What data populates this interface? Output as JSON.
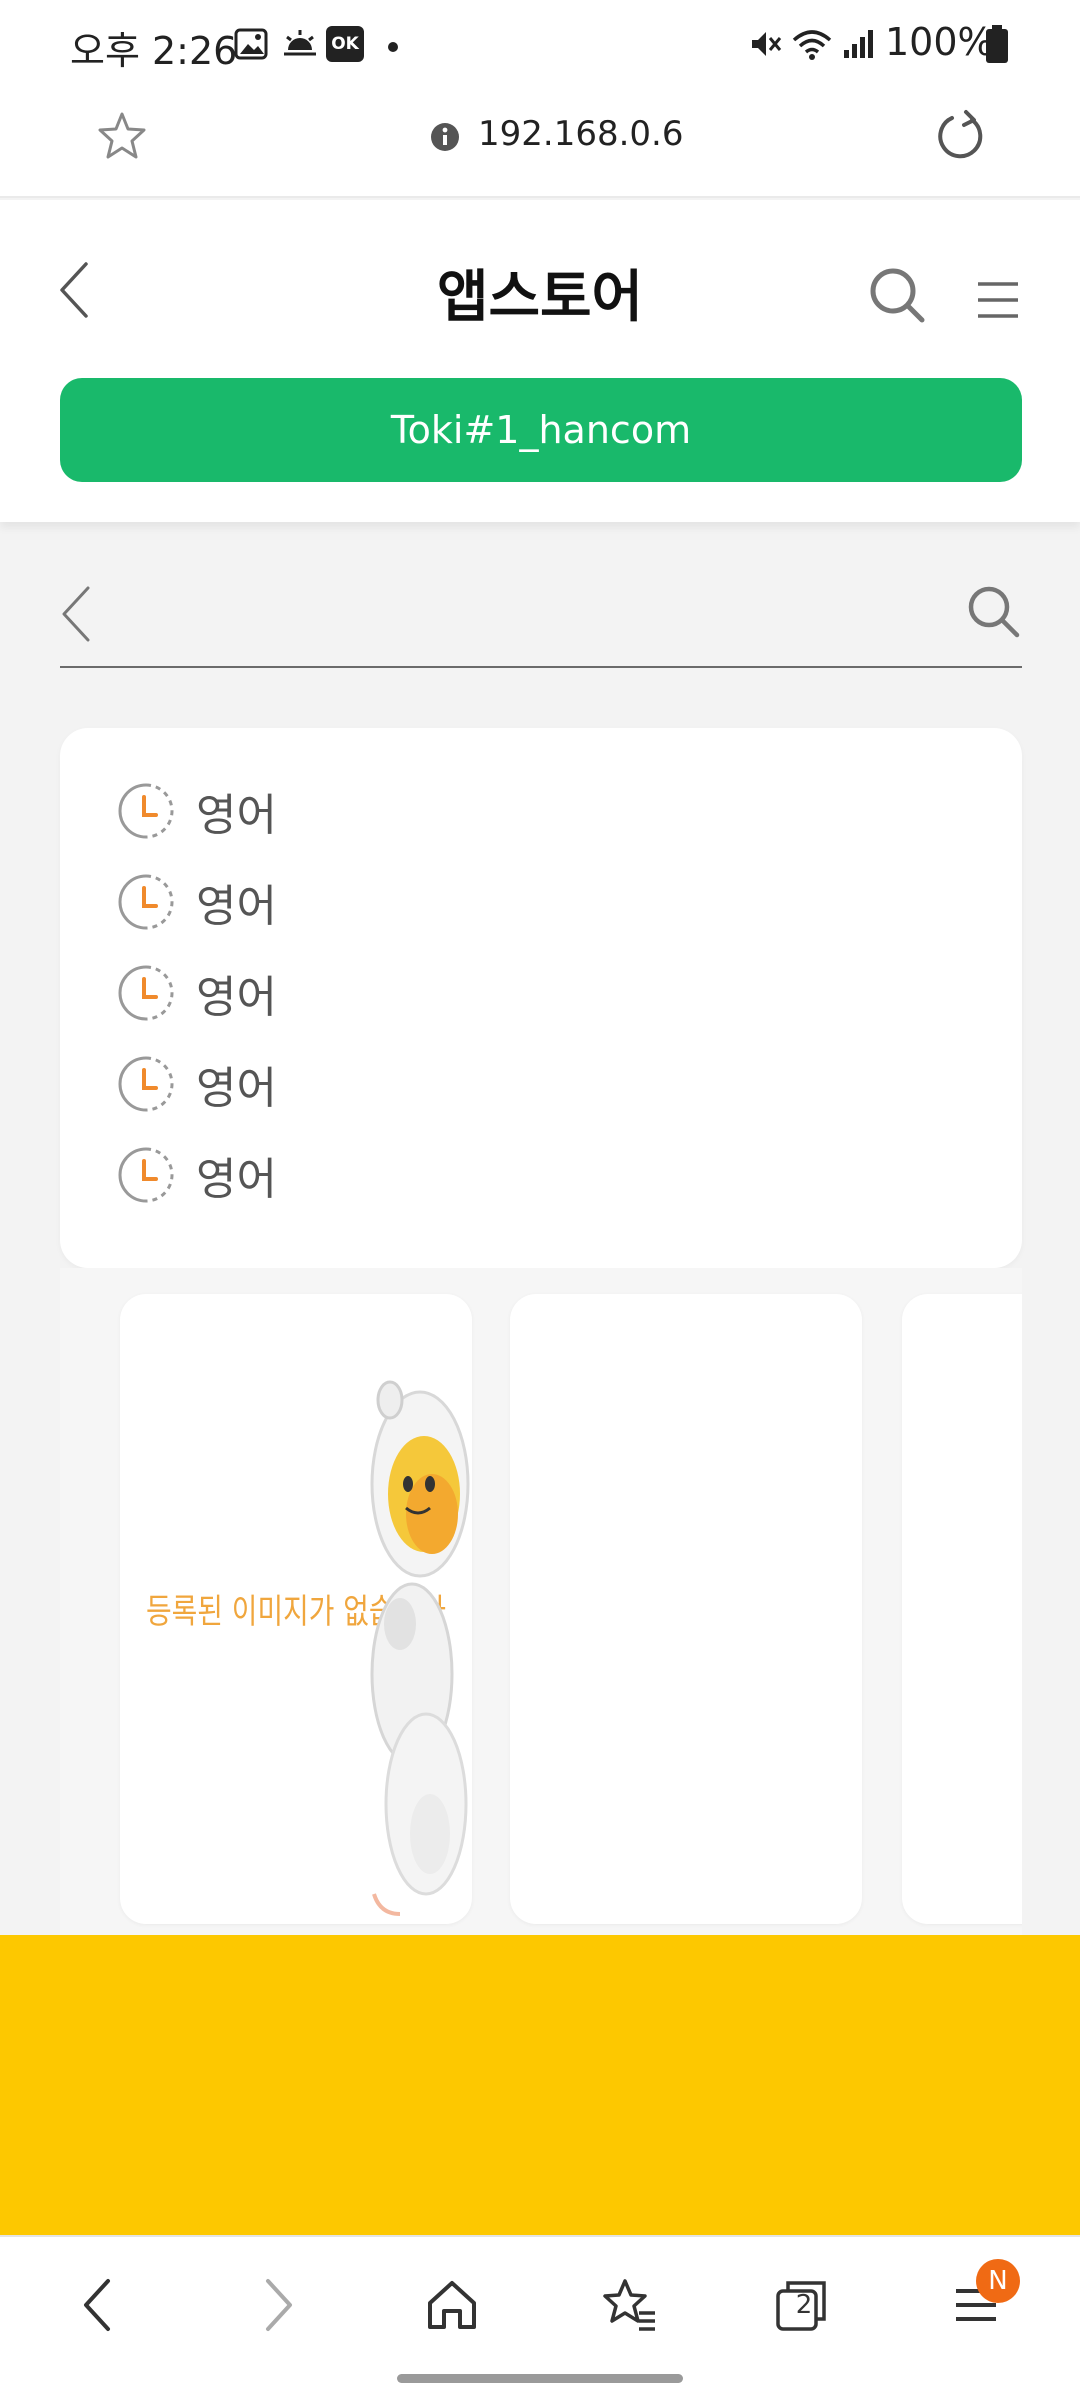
{
  "status_bar": {
    "time": "오후 2:26",
    "ok_badge": "OK",
    "battery": "100%"
  },
  "browser": {
    "url": "192.168.0.6"
  },
  "header": {
    "title": "앱스토어",
    "account_button": "Toki#1_hancom"
  },
  "search": {
    "back_label": "back",
    "value": ""
  },
  "history": {
    "items": [
      {
        "label": "영어"
      },
      {
        "label": "영어"
      },
      {
        "label": "영어"
      },
      {
        "label": "영어"
      },
      {
        "label": "영어"
      }
    ]
  },
  "carousel": {
    "no_image_text": "등록된 이미지가 없습니다"
  },
  "bottom_nav": {
    "tabs_count": "2",
    "menu_badge": "N"
  },
  "colors": {
    "accent_green": "#19b96b",
    "banner_yellow": "#fdc800",
    "badge_orange": "#f06a14",
    "clock_orange": "#f08a2c"
  }
}
